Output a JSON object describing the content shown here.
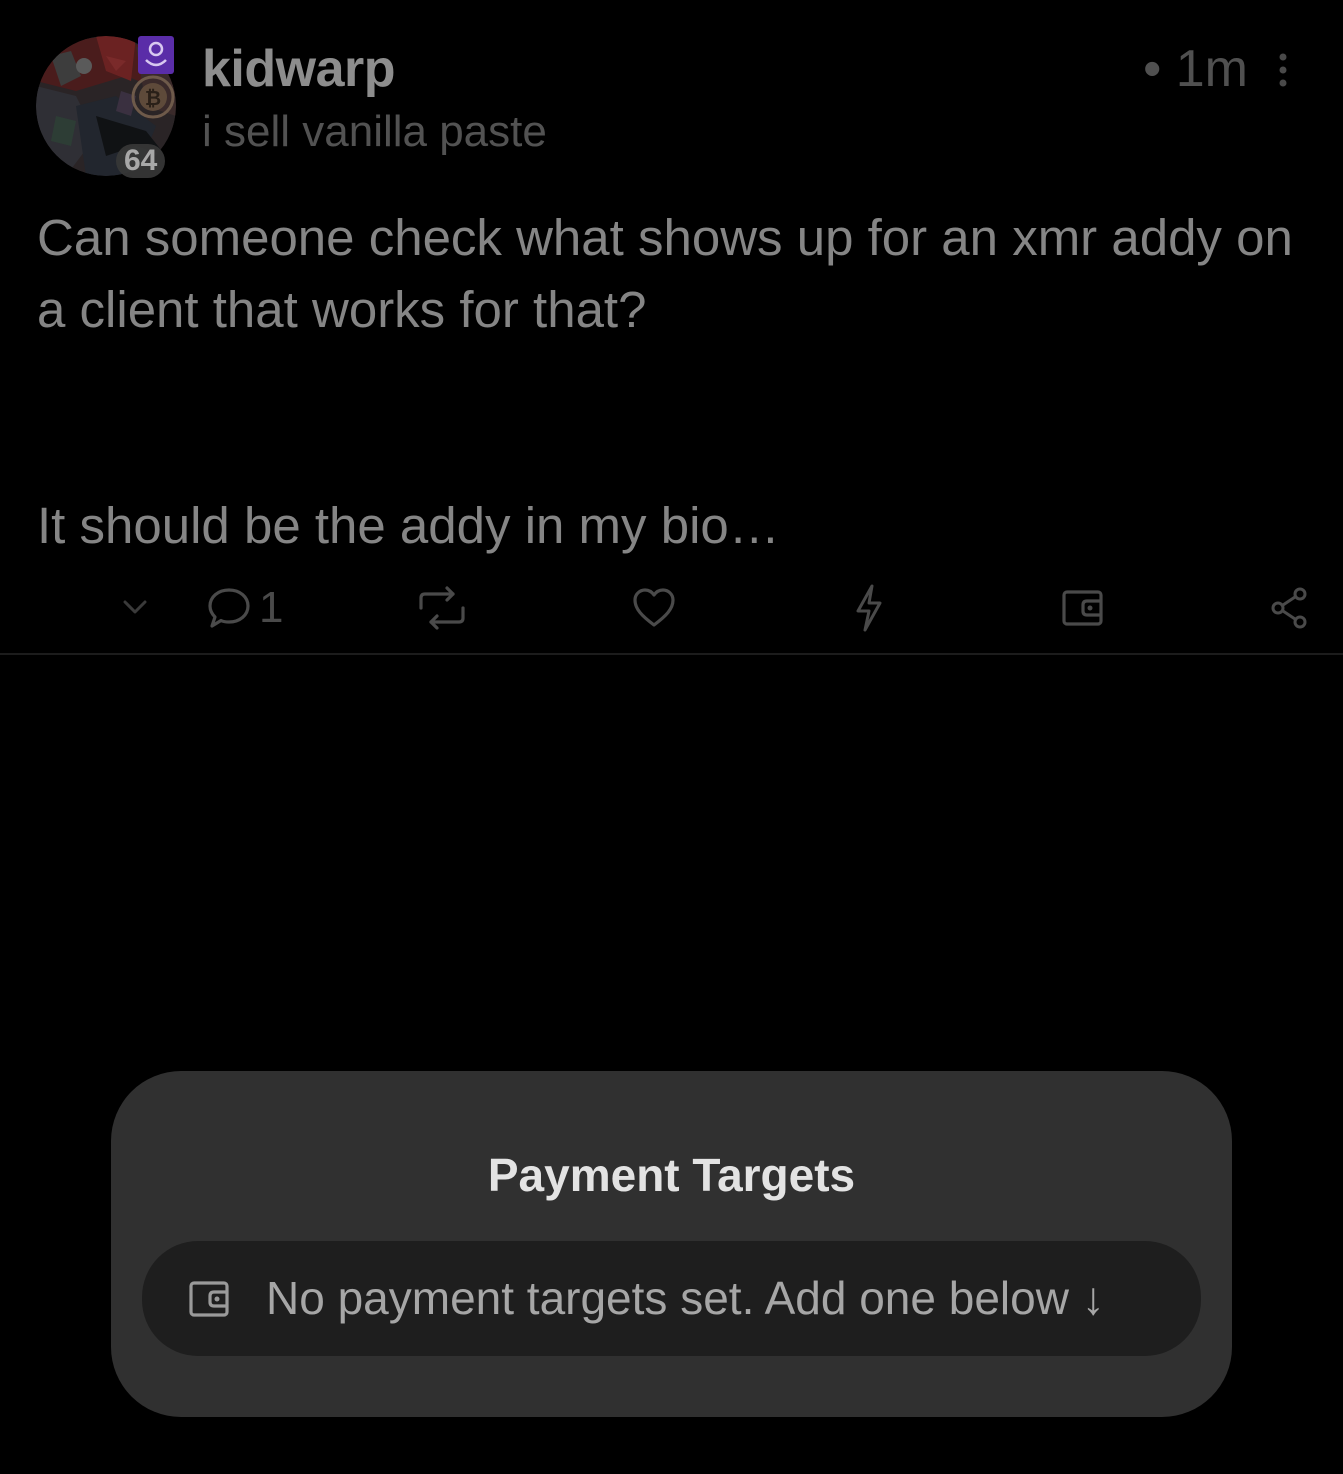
{
  "post": {
    "username": "kidwarp",
    "subtitle": "i sell vanilla paste",
    "timestamp": "• 1m",
    "level_badge": "64",
    "avatar_badges": [
      "verified-shield-icon",
      "bitcoin-icon"
    ],
    "body": {
      "paragraph_1": "Can someone check what shows up for an xmr addy on a client that works for that?",
      "paragraph_2": "It should be the addy in my bio…"
    },
    "actions": {
      "reply_count": "1",
      "icons": [
        "chevron-down-icon",
        "reply-icon",
        "repost-icon",
        "like-icon",
        "zap-icon",
        "wallet-icon",
        "share-icon"
      ]
    }
  },
  "modal": {
    "title": "Payment Targets",
    "notice_text": "No payment targets set. Add one below ↓",
    "notice_icon": "wallet-icon"
  },
  "colors": {
    "background": "#000000",
    "modal_background": "#303030",
    "notice_background": "#1e1e1e",
    "verified_badge": "#5a2da8"
  }
}
